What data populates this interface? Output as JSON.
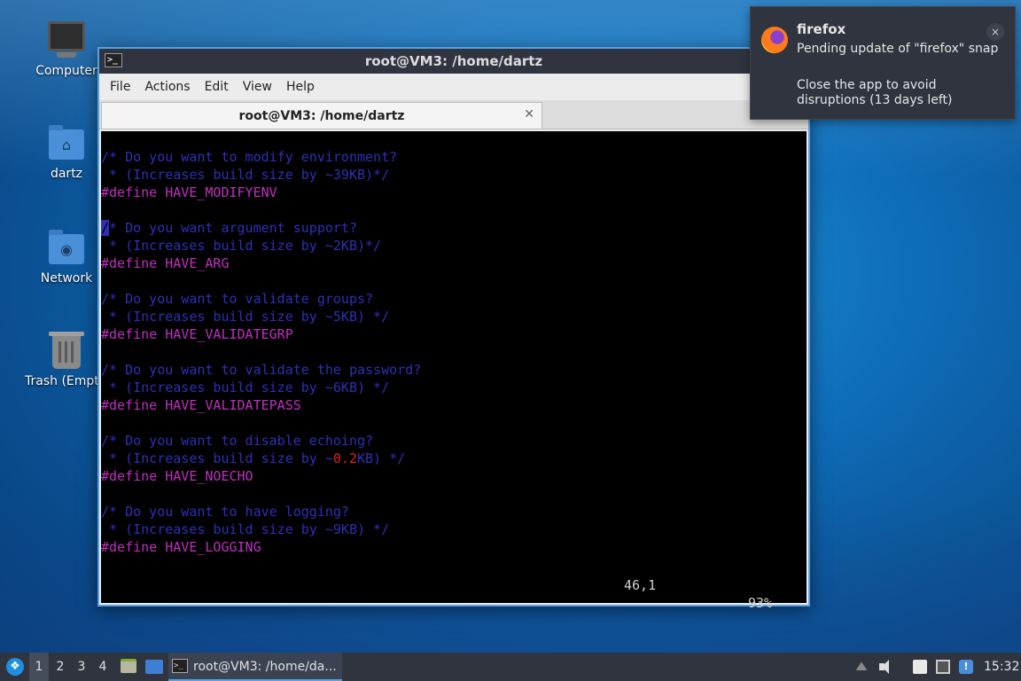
{
  "desktop": {
    "icons": [
      {
        "label": "Computer"
      },
      {
        "label": "dartz"
      },
      {
        "label": "Network"
      },
      {
        "label": "Trash (Empt"
      }
    ]
  },
  "terminal": {
    "window_title": "root@VM3: /home/dartz",
    "menu": [
      "File",
      "Actions",
      "Edit",
      "View",
      "Help"
    ],
    "tab_title": "root@VM3: /home/dartz",
    "lines": [
      {
        "text": "/* Do you want to modify environment?",
        "type": "comment"
      },
      {
        "text": " * (Increases build size by ~39KB)*/",
        "type": "comment"
      },
      {
        "text": "#define HAVE_MODIFYENV",
        "type": "define"
      },
      {
        "text": "",
        "type": "blank"
      },
      {
        "text": "/* Do you want argument support?",
        "type": "comment-cursor"
      },
      {
        "text": " * (Increases build size by ~2KB)*/",
        "type": "comment"
      },
      {
        "text": "#define HAVE_ARG",
        "type": "define"
      },
      {
        "text": "",
        "type": "blank"
      },
      {
        "text": "/* Do you want to validate groups?",
        "type": "comment"
      },
      {
        "text": " * (Increases build size by ~5KB) */",
        "type": "comment"
      },
      {
        "text": "#define HAVE_VALIDATEGRP",
        "type": "define"
      },
      {
        "text": "",
        "type": "blank"
      },
      {
        "text": "/* Do you want to validate the password?",
        "type": "comment"
      },
      {
        "text": " * (Increases build size by ~6KB) */",
        "type": "comment"
      },
      {
        "text": "#define HAVE_VALIDATEPASS",
        "type": "define"
      },
      {
        "text": "",
        "type": "blank"
      },
      {
        "text": "/* Do you want to disable echoing?",
        "type": "comment"
      },
      {
        "text_pre": " * (Increases build size by ~",
        "text_num": "0.2",
        "text_post": "KB) */",
        "type": "comment-num"
      },
      {
        "text": "#define HAVE_NOECHO",
        "type": "define"
      },
      {
        "text": "",
        "type": "blank"
      },
      {
        "text": "/* Do you want to have logging?",
        "type": "comment"
      },
      {
        "text": " * (Increases build size by ~9KB) */",
        "type": "comment"
      },
      {
        "text": "#define HAVE_LOGGING",
        "type": "define"
      }
    ],
    "status_position": "46,1",
    "status_percent": "93%"
  },
  "notification": {
    "app": "firefox",
    "message": "Pending update of \"firefox\" snap",
    "detail": "Close the app to avoid disruptions (13 days left)",
    "close_label": "×"
  },
  "taskbar": {
    "workspaces": [
      "1",
      "2",
      "3",
      "4"
    ],
    "active_workspace": "1",
    "task_label": "root@VM3: /home/da...",
    "clock": "15:32"
  },
  "colors": {
    "comment": "#2f2fb8",
    "define": "#c02fc0",
    "number": "#e02020",
    "panel": "#2f343f"
  }
}
